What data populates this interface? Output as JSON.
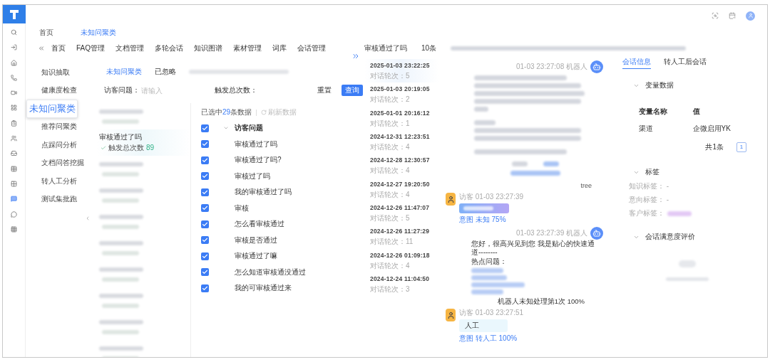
{
  "sidebar": {
    "items": [
      {
        "selected": false
      },
      {
        "selected": false
      },
      {
        "selected": false
      },
      {
        "selected": false
      },
      {
        "selected": false
      },
      {
        "selected": false
      },
      {
        "selected": false
      },
      {
        "selected": false
      },
      {
        "selected": false
      },
      {
        "selected": false
      },
      {
        "selected": false
      },
      {
        "selected": true
      },
      {
        "selected": false
      },
      {
        "selected": false
      }
    ]
  },
  "breadcrumb": [
    {
      "label": "首页",
      "selected": false
    },
    {
      "label": "未知问聚类",
      "selected": true
    }
  ],
  "nav": {
    "items": [
      "首页",
      "FAQ管理",
      "文档管理",
      "多轮会话",
      "知识图谱",
      "素材管理",
      "词库",
      "会话管理"
    ]
  },
  "submenu": {
    "items": [
      {
        "label": "知识抽取",
        "selected": false
      },
      {
        "label": "健康度检查",
        "selected": false
      },
      {
        "label": "未知问聚类",
        "selected": true
      },
      {
        "label": "推荐问聚类",
        "selected": false
      },
      {
        "label": "点踩问分析",
        "selected": false
      },
      {
        "label": "文档问答挖掘",
        "selected": false
      },
      {
        "label": "转人工分析",
        "selected": false
      },
      {
        "label": "测试集批跑",
        "selected": false
      }
    ]
  },
  "tabs": [
    {
      "label": "未知问聚类",
      "selected": true
    },
    {
      "label": "已忽略",
      "selected": false
    }
  ],
  "filter": {
    "fields": [
      {
        "label": "访客问题：",
        "placeholder": "请输入"
      },
      {
        "label": "触发总次数："
      }
    ],
    "buttons": [
      {
        "label": "重置",
        "kind": "default"
      },
      {
        "label": "查询",
        "kind": "primary"
      }
    ]
  },
  "clusters": [
    {
      "kind": "redacted",
      "selected": false
    },
    {
      "kind": "text",
      "title": "审核通过了吗",
      "count_label": "触发总次数",
      "count": "89",
      "selected": true
    },
    {
      "kind": "redacted",
      "selected": false
    },
    {
      "kind": "redacted",
      "selected": false
    },
    {
      "kind": "redacted",
      "selected": false
    },
    {
      "kind": "redacted",
      "selected": false
    },
    {
      "kind": "redacted",
      "selected": false
    },
    {
      "kind": "redacted",
      "selected": false
    },
    {
      "kind": "redacted",
      "selected": false
    },
    {
      "kind": "redacted",
      "selected": false
    }
  ],
  "tree": {
    "summary_prefix": "已选中",
    "summary_count": "29",
    "summary_suffix": "条数据",
    "refresh": "刷新数据",
    "header": {
      "label": "访客问题",
      "checked": true,
      "expanded": true
    },
    "rows": [
      {
        "label": "审核通过了吗",
        "checked": true
      },
      {
        "label": "审核通过了吗?",
        "checked": true
      },
      {
        "label": "审核过了吗",
        "checked": true
      },
      {
        "label": "我的审核通过了吗",
        "checked": true
      },
      {
        "label": "审核",
        "checked": true
      },
      {
        "label": "怎么看审核通过",
        "checked": true
      },
      {
        "label": "审核是否通过",
        "checked": true
      },
      {
        "label": "审核通过了嘛",
        "checked": true
      },
      {
        "label": "怎么知道审核通没通过",
        "checked": true
      },
      {
        "label": "我的可审核通过来",
        "checked": true
      }
    ]
  },
  "sessions": {
    "title": "审核通过了吗",
    "count": "10条",
    "items": [
      {
        "time": "2025-01-03 23:22:25",
        "rounds": "对话轮次：5",
        "selected": true
      },
      {
        "time": "2025-01-03 20:19:05",
        "rounds": "对话轮次：2",
        "selected": false
      },
      {
        "time": "2025-01-01 20:16:12",
        "rounds": "对话轮次：1",
        "selected": false
      },
      {
        "time": "2024-12-31 12:23:51",
        "rounds": "对话轮次：4",
        "selected": false
      },
      {
        "time": "2024-12-28 12:30:57",
        "rounds": "对话轮次：4",
        "selected": false
      },
      {
        "time": "2024-12-27 19:20:50",
        "rounds": "对话轮次：4",
        "selected": false
      },
      {
        "time": "2024-12-26 11:47:07",
        "rounds": "对话轮次：5",
        "selected": false
      },
      {
        "time": "2024-12-26 11:27:29",
        "rounds": "对话轮次：11",
        "selected": false
      },
      {
        "time": "2024-12-26 01:09:18",
        "rounds": "对话轮次：4",
        "selected": false
      },
      {
        "time": "2024-12-24 11:04:50",
        "rounds": "对话轮次：3",
        "selected": false
      }
    ]
  },
  "chat": [
    {
      "kind": "robot_redacted",
      "meta": "01-03 23:27:08 机器人"
    },
    {
      "kind": "note",
      "text": "tree"
    },
    {
      "kind": "visitor_redacted",
      "meta": "访客 01-03 23:27:39",
      "intent_label": "意图",
      "intent": "未知 75%"
    },
    {
      "kind": "robot",
      "meta": "01-03 23:27:39 机器人",
      "text": "您好，很高兴见到您 我是贴心的快速通道--------",
      "subtitle": "热点问题：",
      "footer": "机器人未知处理第1次 100%"
    },
    {
      "kind": "visitor",
      "meta": "访客 01-03 23:27:51",
      "text": "人工",
      "intent_label": "意图",
      "intent": "转人工 100%"
    }
  ],
  "info": {
    "tabs": [
      {
        "label": "会话信息",
        "selected": true
      },
      {
        "label": "转人工后会话",
        "selected": false
      }
    ],
    "variables": {
      "title": "变量数据",
      "expanded": true,
      "columns": [
        "变量名称",
        "值"
      ],
      "rows": [
        [
          "渠道",
          "企微启用YK"
        ]
      ],
      "total": "共1条",
      "page": "1"
    },
    "tags": {
      "title": "标签",
      "expanded": true,
      "items": [
        {
          "kind": "text",
          "label": "知识标签： -"
        },
        {
          "kind": "text",
          "label": "意向标签： -"
        },
        {
          "kind": "tag",
          "label": "客户标签："
        }
      ]
    },
    "rating": {
      "title": "会话满意度评价",
      "expanded": true
    }
  }
}
